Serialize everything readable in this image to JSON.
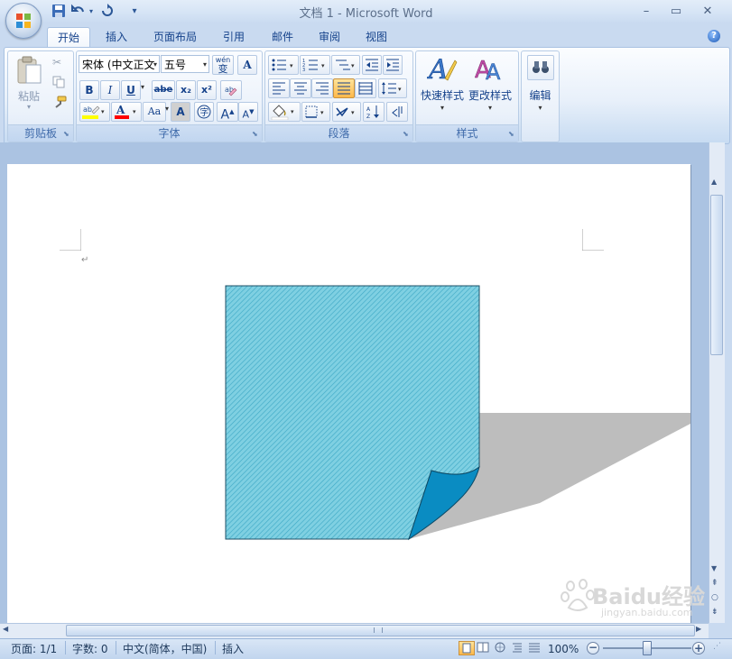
{
  "window": {
    "title": "文档 1 - Microsoft Word",
    "minimize": "–",
    "restore": "▭",
    "close": "✕"
  },
  "quick_access": {
    "save_icon": "save-icon",
    "undo_icon": "undo-icon",
    "redo_icon": "redo-icon",
    "customize_icon": "customize-icon"
  },
  "tabs": [
    {
      "label": "开始",
      "active": true
    },
    {
      "label": "插入",
      "active": false
    },
    {
      "label": "页面布局",
      "active": false
    },
    {
      "label": "引用",
      "active": false
    },
    {
      "label": "邮件",
      "active": false
    },
    {
      "label": "审阅",
      "active": false
    },
    {
      "label": "视图",
      "active": false
    }
  ],
  "help": "?",
  "ribbon": {
    "clipboard": {
      "label": "剪贴板",
      "paste": "粘贴"
    },
    "font": {
      "label": "字体",
      "font_name": "宋体 (中文正文",
      "font_size": "五号",
      "phonetic": "wén",
      "phonetic_char": "变",
      "bold": "B",
      "italic": "I",
      "underline": "U",
      "strikethrough": "abe",
      "subscript": "x₂",
      "superscript": "x²",
      "change_case": "Aa",
      "grow_font": "A",
      "shrink_font": "A"
    },
    "paragraph": {
      "label": "段落"
    },
    "styles": {
      "label": "样式",
      "quick_styles": "快速样式",
      "change_styles": "更改样式"
    },
    "editing": {
      "label": "编辑"
    }
  },
  "status": {
    "page": "页面: 1/1",
    "words": "字数: 0",
    "language": "中文(简体，中国)",
    "mode": "插入",
    "zoom": "100%",
    "zoom_level": 1.0
  },
  "watermark": {
    "text": "Baidu经验",
    "url": "jingyan.baidu.com"
  },
  "colors": {
    "note_fill": "#7fd0e2",
    "note_hatch": "#3fa9c6",
    "curl_fill": "#0a8cc2",
    "shadow": "#bdbdbd",
    "highlight": "#ffff00",
    "font_color": "#ff0000"
  }
}
